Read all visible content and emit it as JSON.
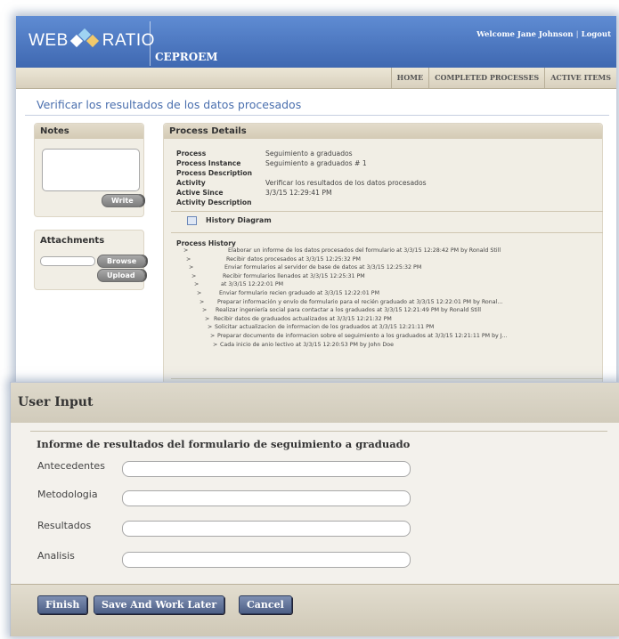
{
  "header": {
    "logo_left": "WEB",
    "logo_right": "RATIO",
    "app_name": "CEPROEM",
    "welcome": "Welcome Jane Johnson",
    "logout": "Logout",
    "colors": {
      "header": "#4f7cc4",
      "diamond_1": "#ffffff",
      "diamond_2": "#9fd3f2",
      "diamond_3": "#f2c96b"
    }
  },
  "nav": {
    "items": [
      "HOME",
      "COMPLETED PROCESSES",
      "ACTIVE ITEMS"
    ]
  },
  "page": {
    "title": "Verificar los resultados de los datos procesados"
  },
  "notes": {
    "title": "Notes",
    "write": "Write"
  },
  "attachments": {
    "title": "Attachments",
    "browse": "Browse",
    "upload": "Upload"
  },
  "process_details": {
    "title": "Process Details",
    "rows": [
      {
        "label": "Process",
        "value": "Seguimiento a graduados"
      },
      {
        "label": "Process Instance",
        "value": "Seguimiento a graduados # 1"
      },
      {
        "label": "Process Description",
        "value": ""
      },
      {
        "label": "Activity",
        "value": "Verificar los resultados de los datos procesados"
      },
      {
        "label": "Active Since",
        "value": "3/3/15 12:29:41 PM"
      },
      {
        "label": "Activity Description",
        "value": ""
      }
    ],
    "history_diagram": "History Diagram",
    "history_title": "Process History",
    "history": [
      "Elaborar un informe de los datos procesados del formulario at 3/3/15 12:28:42 PM by Ronald Still",
      "Recibir datos procesados at 3/3/15 12:25:32 PM",
      "Enviar formularios al servidor de base de datos at 3/3/15 12:25:32 PM",
      "Recibir formularios llenados at 3/3/15 12:25:31 PM",
      "at 3/3/15 12:22:01 PM",
      "Enviar formulario recien graduado at 3/3/15 12:22:01 PM",
      "Preparar información y envío de formulario para el recién graduado at 3/3/15 12:22:01 PM by Ronal...",
      "Realizar ingeniería social para contactar a los graduados at 3/3/15 12:21:49 PM by Ronald Still",
      "Recibir datos de graduados actualizados at 3/3/15 12:21:32 PM",
      "Solicitar actualizacion de informacion de los graduados at 3/3/15 12:21:11 PM",
      "Preparar documento de informacion sobre el seguimiento a los graduados at 3/3/15 12:21:11 PM by J...",
      "Cada inicio de anio lectivo at 3/3/15 12:20:53 PM by John Doe"
    ],
    "history_marker": ">"
  },
  "dialog": {
    "title": "User Input",
    "form_title": "Informe de resultados del formulario de seguimiento a graduado",
    "fields": [
      {
        "label": "Antecedentes",
        "value": ""
      },
      {
        "label": "Metodologia",
        "value": ""
      },
      {
        "label": "Resultados",
        "value": ""
      },
      {
        "label": "Analisis",
        "value": ""
      }
    ],
    "buttons": {
      "finish": "Finish",
      "save": "Save And Work Later",
      "cancel": "Cancel"
    }
  }
}
